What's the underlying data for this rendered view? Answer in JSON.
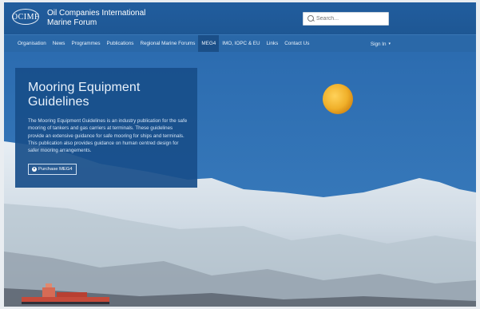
{
  "header": {
    "logo_text": "OCIMF",
    "org_line1": "Oil Companies International",
    "org_line2": "Marine Forum",
    "search_placeholder": "Search..."
  },
  "nav": {
    "items": [
      {
        "label": "Organisation"
      },
      {
        "label": "News"
      },
      {
        "label": "Programmes"
      },
      {
        "label": "Publications"
      },
      {
        "label": "Regional Marine Forums"
      },
      {
        "label": "MEG4"
      },
      {
        "label": "IMO, IOPC & EU"
      },
      {
        "label": "Links"
      },
      {
        "label": "Contact Us"
      }
    ],
    "active_item": "MEG4",
    "sign_in": "Sign In"
  },
  "hero": {
    "title": "Mooring Equipment Guidelines",
    "body": "The Mooring Equipment Guidelines is an industry publication for the safe mooring of tankers and gas carriers at terminals. These guidelines provide an extensive guidance for safe mooring for ships and terminals. This publication also provides guidance on human centred design for safer mooring arrangements.",
    "button_label": "Purchase MEG4"
  },
  "colors": {
    "header_bg": "#215d9e",
    "nav_bg": "#2a68a8",
    "active_nav_bg": "#1b4f88",
    "panel_bg": "#184e8a",
    "sky": "#2d6db0",
    "moon": "#f0b62a"
  }
}
